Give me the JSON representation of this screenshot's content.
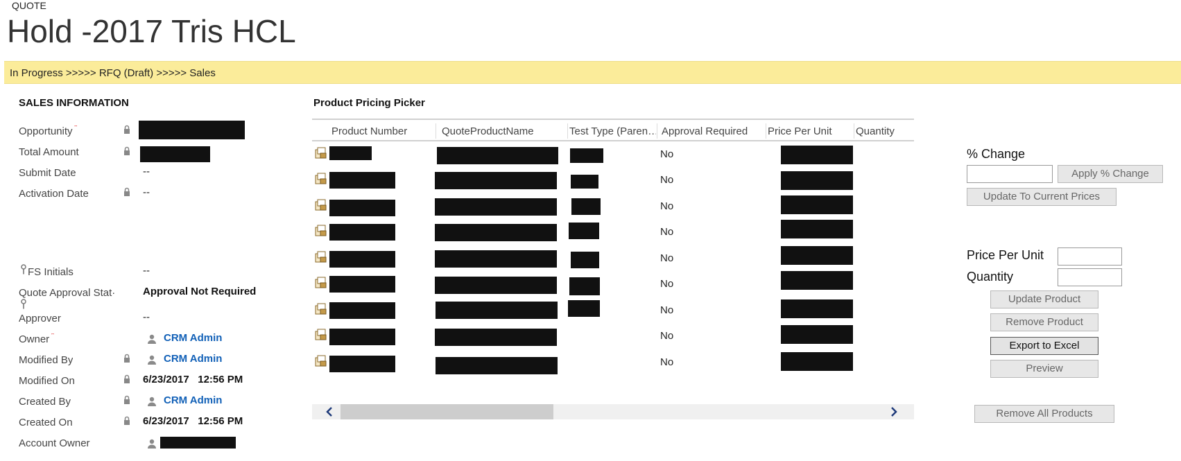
{
  "header": {
    "entity_type": "QUOTE",
    "title": "Hold -2017 Tris HCL"
  },
  "stage_bar": {
    "text": "In Progress >>>>> RFQ (Draft) >>>>> Sales"
  },
  "sales_info": {
    "title": "SALES INFORMATION",
    "fields": [
      {
        "label": "Opportunity",
        "value": ""
      },
      {
        "label": "Total Amount",
        "value": ""
      },
      {
        "label": "Submit Date",
        "value": "--"
      },
      {
        "label": "Activation Date",
        "value": "--"
      },
      {
        "label": "FS Initials",
        "value": "--"
      },
      {
        "label": "Quote Approval Stat·",
        "value": "Approval Not Required"
      },
      {
        "label": "Approver",
        "value": "--"
      },
      {
        "label": "Owner",
        "value": "CRM Admin"
      },
      {
        "label": "Modified By",
        "value": "CRM Admin"
      },
      {
        "label": "Modified On",
        "value": "6/23/2017   12:56 PM"
      },
      {
        "label": "Created By",
        "value": "CRM Admin"
      },
      {
        "label": "Created On",
        "value": "6/23/2017   12:56 PM"
      },
      {
        "label": "Account Owner",
        "value": ""
      }
    ],
    "required_marker": "*"
  },
  "product_grid": {
    "title": "Product Pricing Picker",
    "columns": [
      "Product Number",
      "QuoteProductName",
      "Test Type (Paren…",
      "Approval Required",
      "Price Per Unit",
      "Quantity"
    ],
    "rows": [
      {
        "approval_required": "No"
      },
      {
        "approval_required": "No"
      },
      {
        "approval_required": "No"
      },
      {
        "approval_required": "No"
      },
      {
        "approval_required": "No"
      },
      {
        "approval_required": "No"
      },
      {
        "approval_required": "No"
      },
      {
        "approval_required": "No"
      },
      {
        "approval_required": "No"
      }
    ],
    "scroll_left_icon": "chevron-left-icon",
    "scroll_right_icon": "chevron-right-icon"
  },
  "pricing_panel": {
    "percent_change_label": "% Change",
    "percent_change_value": "",
    "apply_percent_button": "Apply % Change",
    "update_current_prices_button": "Update To Current Prices",
    "price_per_unit_label": "Price Per Unit",
    "price_per_unit_value": "",
    "quantity_label": "Quantity",
    "quantity_value": "",
    "update_product_button": "Update Product",
    "remove_product_button": "Remove Product",
    "export_excel_button": "Export to Excel",
    "preview_button": "Preview",
    "remove_all_button": "Remove All Products"
  },
  "colors": {
    "stage_bar_bg": "#fbec9a",
    "link": "#1160b7",
    "required": "#e02020"
  }
}
